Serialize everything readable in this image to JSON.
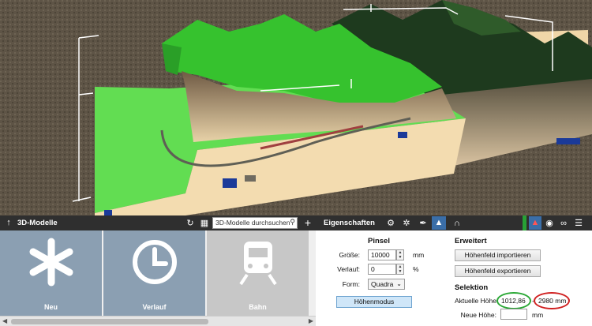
{
  "left_panel": {
    "title": "3D-Modelle",
    "search_placeholder": "3D-Modelle durchsuchen",
    "tiles": [
      {
        "label": "Neu",
        "icon": "asterisk-icon"
      },
      {
        "label": "Verlauf",
        "icon": "clock-icon"
      },
      {
        "label": "Bahn",
        "icon": "train-icon"
      }
    ]
  },
  "right_panel": {
    "title": "Eigenschaften",
    "pinsel": {
      "title": "Pinsel",
      "groesse_label": "Größe:",
      "groesse_value": "10000",
      "groesse_unit": "mm",
      "verlauf_label": "Verlauf:",
      "verlauf_value": "0",
      "verlauf_unit": "%",
      "form_label": "Form:",
      "form_value": "Quadra",
      "mode_button": "Höhenmodus"
    },
    "erweitert": {
      "title": "Erweitert",
      "import_button": "Höhenfeld importieren",
      "export_button": "Höhenfeld exportieren"
    },
    "selektion": {
      "title": "Selektion",
      "current_label": "Aktuelle Höhe:",
      "current_value": "1012,86",
      "separator": "-",
      "current_max": "2980 mm",
      "new_label": "Neue Höhe:",
      "new_value": "",
      "new_unit": "mm"
    }
  },
  "colors": {
    "toolbar": "#2f2f2f",
    "tile": "#8b9fb2",
    "tile_inactive": "#c7c7c7",
    "terrain_green": "#3fd43a",
    "baseboard": "#f2d9ad",
    "accent_blue": "#cfe6f8",
    "highlight_green": "#2aa835",
    "highlight_red": "#d02020"
  }
}
